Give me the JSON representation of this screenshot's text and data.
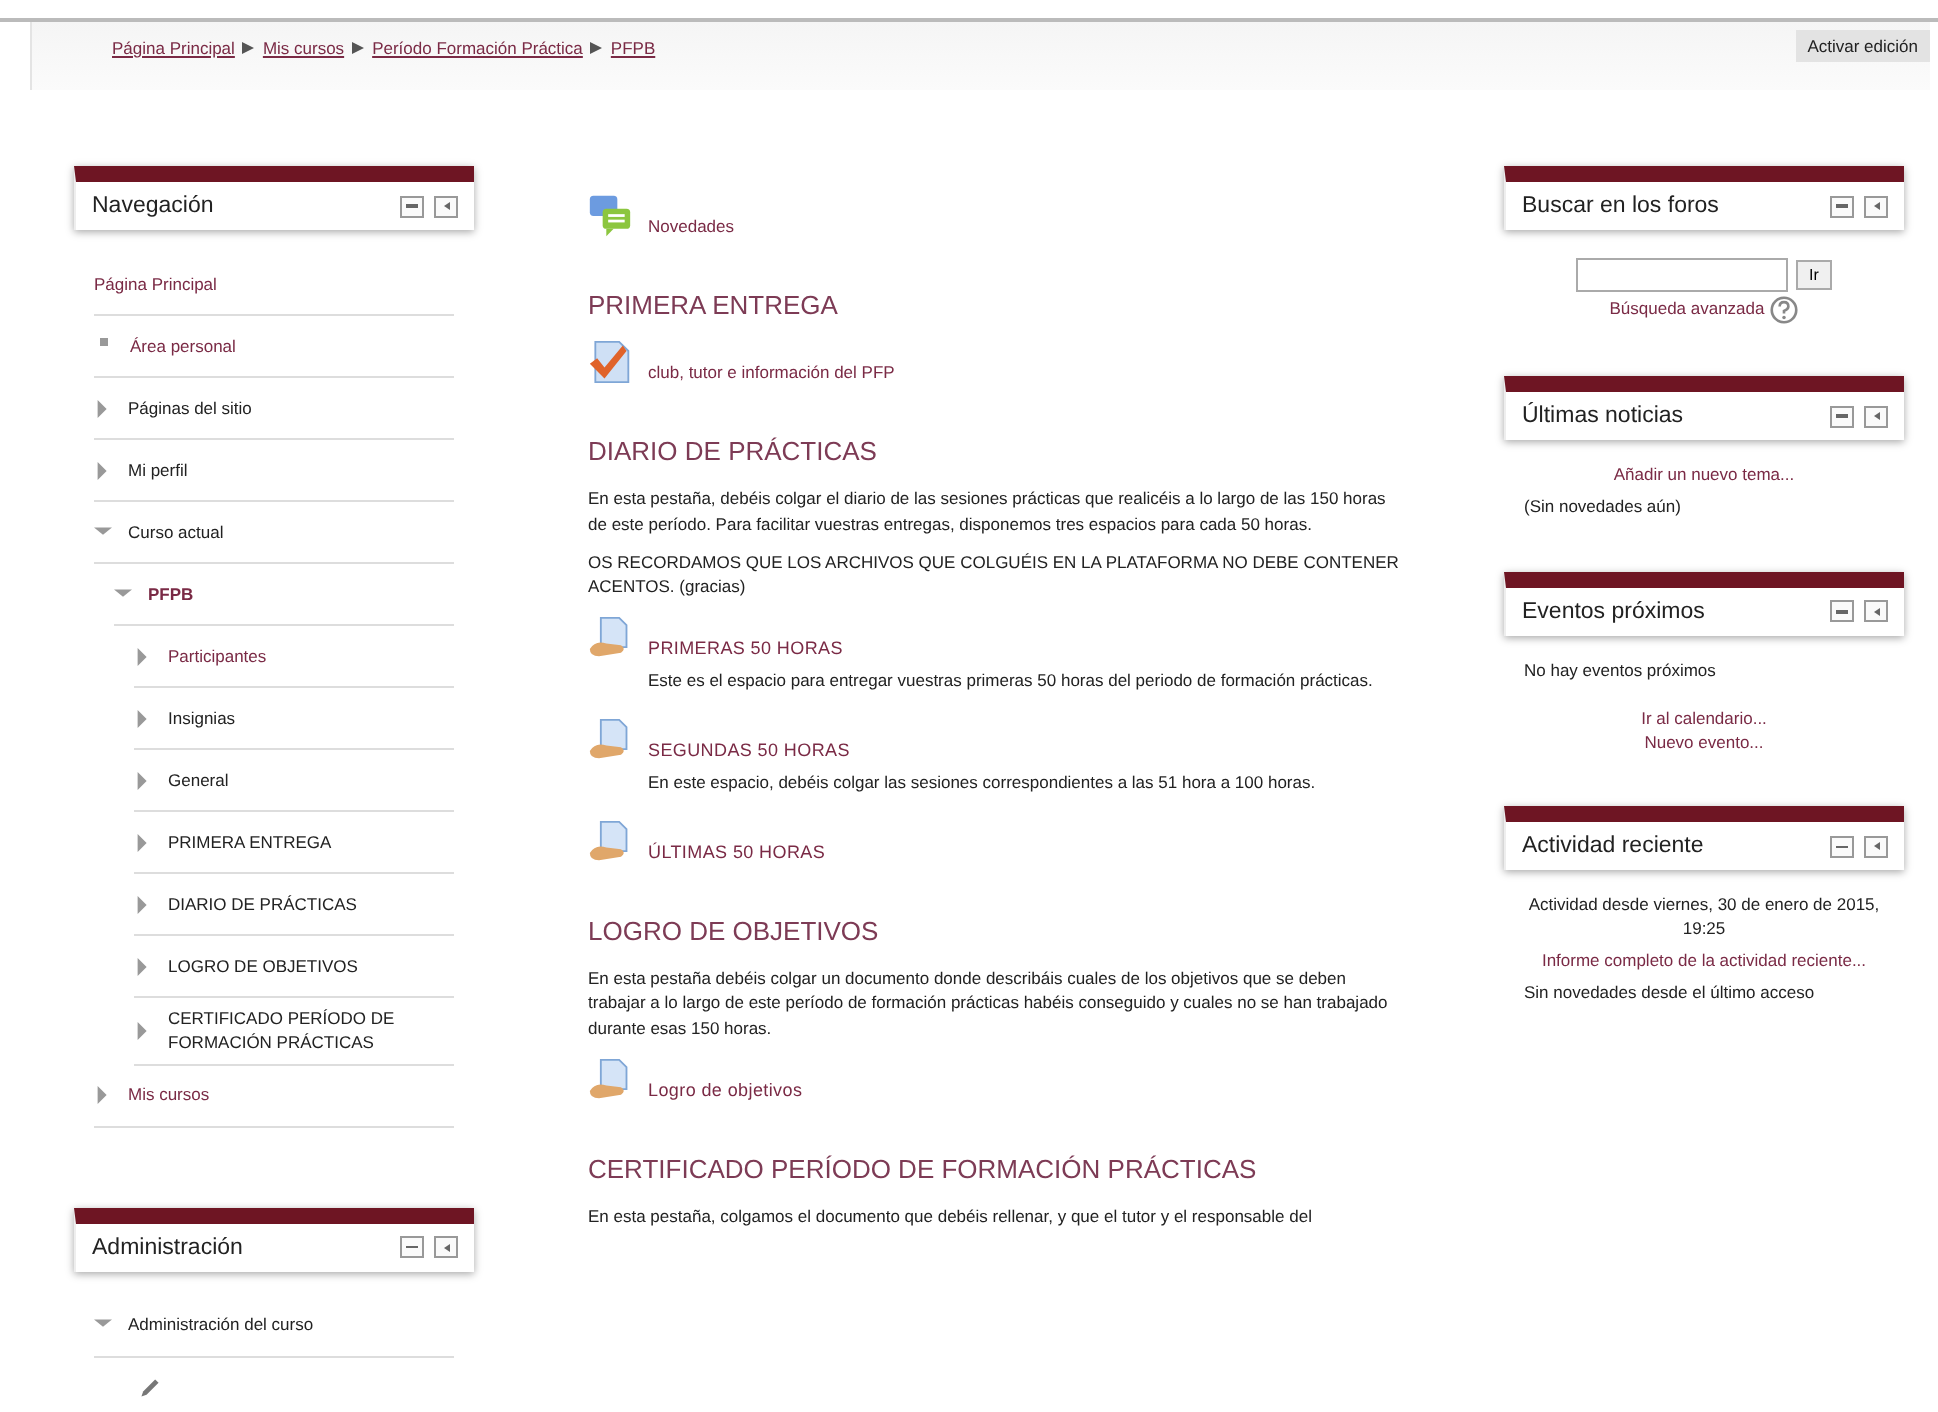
{
  "breadcrumb": [
    "Página Principal",
    "Mis cursos",
    "Período Formación Práctica",
    "PFPB"
  ],
  "edit_button": "Activar edición",
  "navigation": {
    "title": "Navegación",
    "items": [
      {
        "kind": "home",
        "label": "Página Principal",
        "link": true
      },
      {
        "kind": "leaf",
        "label": "Área personal",
        "link": true
      },
      {
        "kind": "branch",
        "label": "Páginas del sitio",
        "link": false,
        "expanded": false
      },
      {
        "kind": "branch",
        "label": "Mi perfil",
        "link": false,
        "expanded": false
      },
      {
        "kind": "branch",
        "label": "Curso actual",
        "link": false,
        "expanded": true,
        "children": [
          {
            "kind": "branch",
            "label": "PFPB",
            "link": true,
            "expanded": true,
            "bold": true,
            "children": [
              {
                "kind": "branch",
                "label": "Participantes",
                "link": true,
                "expanded": false
              },
              {
                "kind": "branch",
                "label": "Insignias",
                "link": false,
                "expanded": false
              },
              {
                "kind": "branch",
                "label": "General",
                "link": false,
                "expanded": false
              },
              {
                "kind": "branch",
                "label": "PRIMERA ENTREGA",
                "link": false,
                "expanded": false
              },
              {
                "kind": "branch",
                "label": "DIARIO DE PRÁCTICAS",
                "link": false,
                "expanded": false
              },
              {
                "kind": "branch",
                "label": "LOGRO DE OBJETIVOS",
                "link": false,
                "expanded": false
              },
              {
                "kind": "branch",
                "label": "CERTIFICADO PERÍODO DE FORMACIÓN PRÁCTICAS",
                "link": false,
                "expanded": false
              }
            ]
          }
        ]
      },
      {
        "kind": "branch",
        "label": "Mis cursos",
        "link": true,
        "expanded": false
      }
    ]
  },
  "administration": {
    "title": "Administración",
    "items": [
      {
        "kind": "branch",
        "label": "Administración del curso",
        "link": false,
        "expanded": true,
        "children": [
          {
            "kind": "edit"
          }
        ]
      }
    ]
  },
  "sections": [
    {
      "activities": [
        {
          "kind": "forum",
          "label": "Novedades"
        }
      ]
    },
    {
      "title": "PRIMERA ENTREGA",
      "activities": [
        {
          "kind": "choice",
          "label": "club, tutor e información del PFP"
        }
      ]
    },
    {
      "title": "DIARIO DE PRÁCTICAS",
      "summary": [
        "En esta pestaña, debéis colgar el diario de las sesiones prácticas que realicéis a lo largo de las 150 horas de este período. Para facilitar vuestras entregas, disponemos tres espacios para cada 50 horas.",
        "OS RECORDAMOS QUE LOS ARCHIVOS QUE COLGUÉIS EN LA PLATAFORMA NO DEBE CONTENER ACENTOS. (gracias)"
      ],
      "activities": [
        {
          "kind": "assign",
          "label": "PRIMERAS 50 HORAS",
          "description": "Este es el espacio para entregar vuestras primeras 50 horas del periodo de formación prácticas."
        },
        {
          "kind": "assign",
          "label": "SEGUNDAS 50 HORAS",
          "description": "En este espacio, debéis colgar las sesiones correspondientes a las 51 hora a 100 horas."
        },
        {
          "kind": "assign",
          "label": "ÚLTIMAS 50 HORAS"
        }
      ]
    },
    {
      "title": "LOGRO DE OBJETIVOS",
      "summary": [
        "En  esta pestaña debéis colgar un documento donde describáis cuales de los objetivos que se deben trabajar a lo largo de este período de formación prácticas habéis conseguido y cuales no se han trabajado durante esas 150 horas."
      ],
      "activities": [
        {
          "kind": "assign",
          "label": "Logro de objetivos"
        }
      ]
    },
    {
      "title": "CERTIFICADO PERÍODO DE FORMACIÓN PRÁCTICAS",
      "summary": [
        "En esta pestaña, colgamos el documento que debéis rellenar, y que el tutor y el responsable del"
      ]
    }
  ],
  "blocks": [
    {
      "kind": "search",
      "title": "Buscar en los foros",
      "button": "Ir",
      "link": "Búsqueda avanzada"
    },
    {
      "kind": "news",
      "title": "Últimas noticias",
      "link": "Añadir un nuevo tema...",
      "text": "(Sin novedades aún)"
    },
    {
      "kind": "events",
      "title": "Eventos próximos",
      "text": "No hay eventos próximos",
      "links": [
        "Ir al calendario...",
        "Nuevo evento..."
      ]
    },
    {
      "kind": "recent",
      "title": "Actividad reciente",
      "since": "Actividad desde viernes, 30 de enero de 2015, 19:25",
      "link": "Informe completo de la actividad reciente...",
      "text": "Sin novedades desde el último acceso"
    }
  ]
}
